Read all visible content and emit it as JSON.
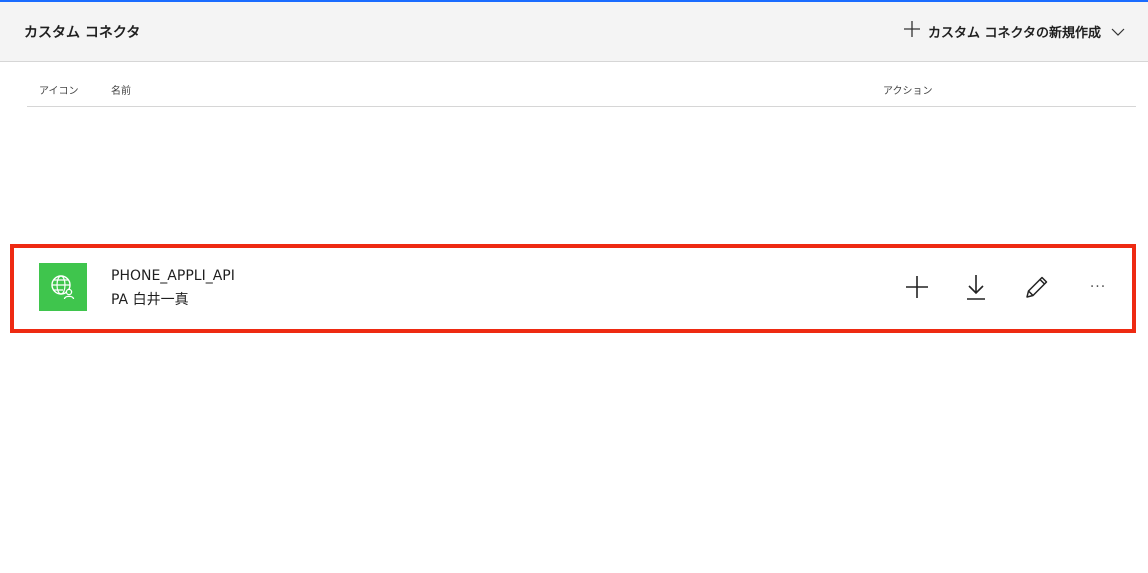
{
  "header": {
    "title": "カスタム コネクタ",
    "new_connector_label": "カスタム コネクタの新規作成"
  },
  "table": {
    "columns": {
      "icon": "アイコン",
      "name": "名前",
      "actions": "アクション"
    },
    "rows": [
      {
        "name": "PHONE_APPLI_API",
        "owner": "PA 白井一真",
        "icon": "globe-person-icon",
        "icon_bg": "#3fc54d",
        "actions": [
          "plus-icon",
          "download-icon",
          "edit-pencil-icon",
          "more-icon"
        ],
        "more_label": "···"
      }
    ]
  },
  "colors": {
    "accent_top": "#1a6cff",
    "highlight_border": "#ee2a12",
    "header_bg": "#f4f4f4"
  }
}
